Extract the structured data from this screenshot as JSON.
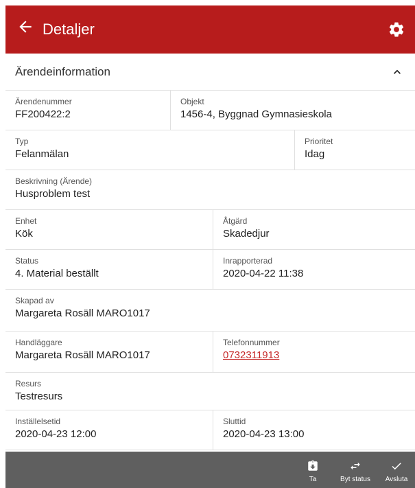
{
  "header": {
    "title": "Detaljer"
  },
  "section": {
    "title": "Ärendeinformation"
  },
  "fields": {
    "arendenummer": {
      "label": "Ärendenummer",
      "value": "FF200422:2"
    },
    "objekt": {
      "label": "Objekt",
      "value": "1456-4, Byggnad Gymnasieskola"
    },
    "typ": {
      "label": "Typ",
      "value": "Felanmälan"
    },
    "prioritet": {
      "label": "Prioritet",
      "value": "Idag"
    },
    "beskrivning": {
      "label": "Beskrivning (Ärende)",
      "value": "Husproblem test"
    },
    "enhet": {
      "label": "Enhet",
      "value": "Kök"
    },
    "atgard": {
      "label": "Åtgärd",
      "value": "Skadedjur"
    },
    "status": {
      "label": "Status",
      "value": "4. Material beställt"
    },
    "inrapporterad": {
      "label": "Inrapporterad",
      "value": "2020-04-22 11:38"
    },
    "skapad_av": {
      "label": "Skapad av",
      "value": "Margareta Rosäll MARO1017"
    },
    "handlaggare": {
      "label": "Handläggare",
      "value": "Margareta Rosäll MARO1017"
    },
    "telefon": {
      "label": "Telefonnummer",
      "value": "0732311913"
    },
    "resurs": {
      "label": "Resurs",
      "value": "Testresurs"
    },
    "installelsetid": {
      "label": "Inställelsetid",
      "value": "2020-04-23 12:00"
    },
    "sluttid": {
      "label": "Sluttid",
      "value": "2020-04-23 13:00"
    }
  },
  "bottom_actions": {
    "take": {
      "label": "Ta",
      "icon": "clipboard-download-icon"
    },
    "change_status": {
      "label": "Byt status",
      "icon": "swap-arrows-icon"
    },
    "finish": {
      "label": "Avsluta",
      "icon": "checkmark-icon"
    }
  },
  "colors": {
    "appbar": "#b71c1c",
    "bottombar": "#5f5f5f",
    "link": "#c62828",
    "status_dot": "#44b044"
  }
}
